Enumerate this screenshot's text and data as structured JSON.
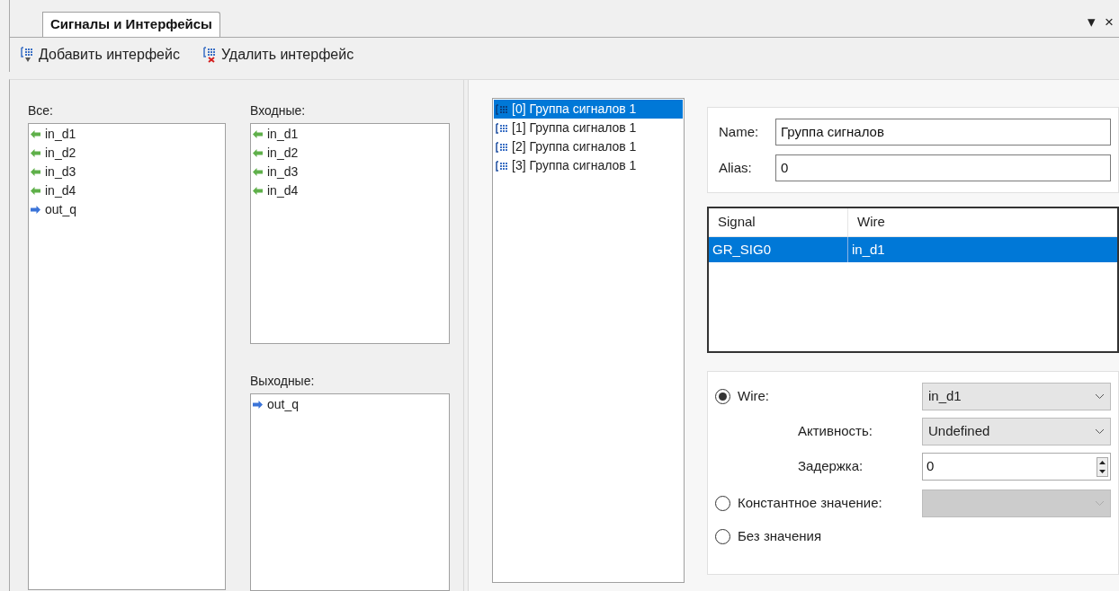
{
  "tab": {
    "label": "Сигналы и Интерфейсы",
    "selected": true
  },
  "window_controls": [
    "▾",
    "×"
  ],
  "toolbar": [
    {
      "kind": "add",
      "label": "Добавить интерфейс"
    },
    {
      "kind": "remove",
      "label": "Удалить интерфейс"
    }
  ],
  "lists": {
    "all": {
      "label": "Все:",
      "items": [
        {
          "label": "in_d1",
          "kind": "input"
        },
        {
          "label": "in_d2",
          "kind": "input"
        },
        {
          "label": "in_d3",
          "kind": "input"
        },
        {
          "label": "in_d4",
          "kind": "input"
        },
        {
          "label": "out_q",
          "kind": "output"
        }
      ]
    },
    "inputs": {
      "label": "Входные:",
      "items": [
        {
          "label": "in_d1",
          "kind": "input"
        },
        {
          "label": "in_d2",
          "kind": "input"
        },
        {
          "label": "in_d3",
          "kind": "input"
        },
        {
          "label": "in_d4",
          "kind": "input"
        }
      ]
    },
    "outputs": {
      "label": "Выходные:",
      "items": [
        {
          "label": "out_q",
          "kind": "output"
        }
      ]
    }
  },
  "groups": [
    {
      "label": "[0] Группа сигналов 1",
      "selected": true
    },
    {
      "label": "[1] Группа сигналов 1",
      "selected": false
    },
    {
      "label": "[2] Группа сигналов 1",
      "selected": false
    },
    {
      "label": "[3] Группа сигналов 1",
      "selected": false
    }
  ],
  "properties": [
    {
      "label": "Name:",
      "value": "Группа сигналов"
    },
    {
      "label": "Alias:",
      "value": "0"
    }
  ],
  "signal_table": {
    "columns": [
      "Signal",
      "Wire"
    ],
    "rows": [
      {
        "cells": [
          "GR_SIG0",
          "in_d1"
        ],
        "selected": true
      }
    ]
  },
  "source": {
    "options": [
      {
        "kind": "wire",
        "label": "Wire:",
        "selected": true,
        "value": "in_d1"
      },
      {
        "kind": "constant",
        "label": "Константное значение:",
        "selected": false,
        "disabled": true
      },
      {
        "kind": "none",
        "label": "Без значения",
        "selected": false
      }
    ],
    "activity": {
      "label": "Активность:",
      "value": "Undefined"
    },
    "delay": {
      "label": "Задержка:",
      "value": "0"
    }
  }
}
